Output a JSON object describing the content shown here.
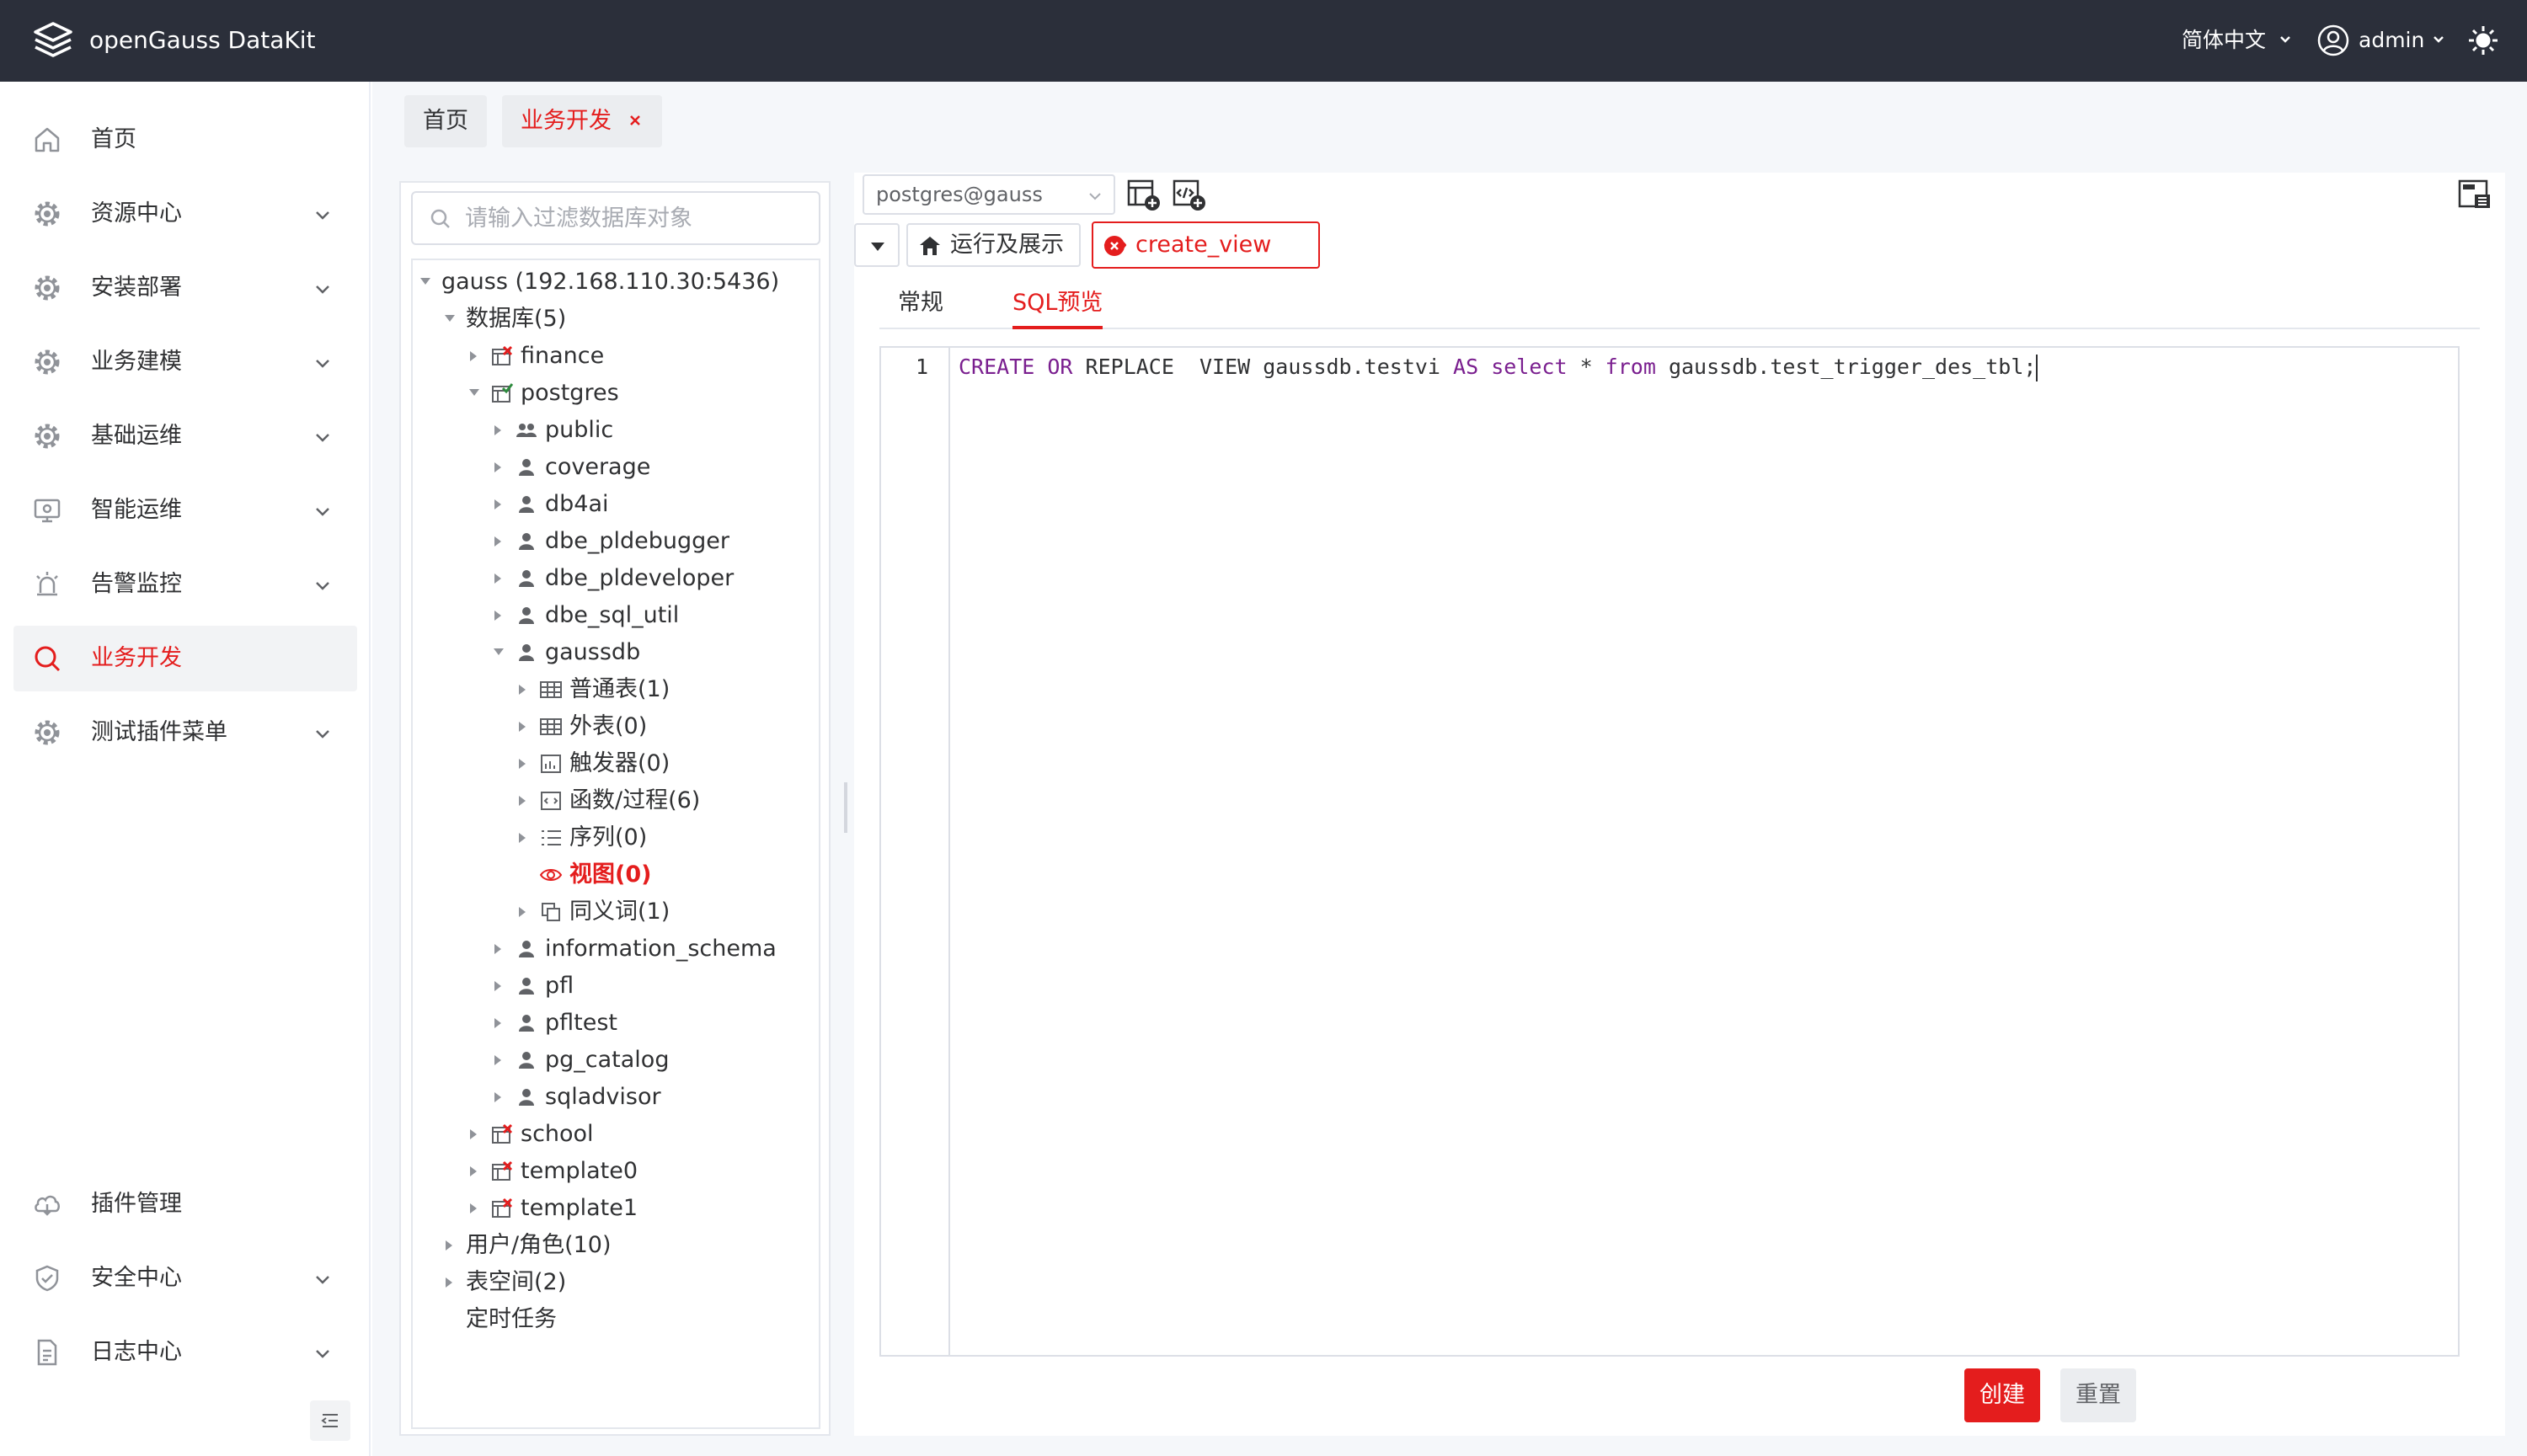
{
  "app": {
    "title": "openGauss DataKit"
  },
  "header": {
    "language": "简体中文",
    "user": "admin"
  },
  "sidebar": {
    "items": [
      {
        "label": "首页",
        "icon": "home-icon"
      },
      {
        "label": "资源中心",
        "icon": "gear-icon"
      },
      {
        "label": "安装部署",
        "icon": "gear-icon"
      },
      {
        "label": "业务建模",
        "icon": "gear-icon"
      },
      {
        "label": "基础运维",
        "icon": "gear-icon"
      },
      {
        "label": "智能运维",
        "icon": "monitor-icon"
      },
      {
        "label": "告警监控",
        "icon": "alarm-icon"
      },
      {
        "label": "业务开发",
        "icon": "search-icon",
        "active": true
      },
      {
        "label": "测试插件菜单",
        "icon": "gear-icon"
      },
      {
        "label": "插件管理",
        "icon": "plugin-icon"
      },
      {
        "label": "安全中心",
        "icon": "shield-icon"
      },
      {
        "label": "日志中心",
        "icon": "document-icon"
      }
    ]
  },
  "tabs": [
    {
      "label": "首页"
    },
    {
      "label": "业务开发"
    }
  ],
  "filter": {
    "placeholder": "请输入过滤数据库对象"
  },
  "tree": [
    {
      "label": "gauss (192.168.110.30:5436)",
      "icon": "none",
      "arrow": "down"
    },
    {
      "label": "数据库(5)",
      "icon": "none",
      "arrow": "down"
    },
    {
      "label": "finance",
      "icon": "database-closed-icon",
      "arrow": "right"
    },
    {
      "label": "postgres",
      "icon": "database-open-icon",
      "arrow": "down"
    },
    {
      "label": "public",
      "icon": "users-icon",
      "arrow": "right"
    },
    {
      "label": "coverage",
      "icon": "user-icon",
      "arrow": "right"
    },
    {
      "label": "db4ai",
      "icon": "user-icon",
      "arrow": "right"
    },
    {
      "label": "dbe_pldebugger",
      "icon": "user-icon",
      "arrow": "right"
    },
    {
      "label": "dbe_pldeveloper",
      "icon": "user-icon",
      "arrow": "right"
    },
    {
      "label": "dbe_sql_util",
      "icon": "user-icon",
      "arrow": "right"
    },
    {
      "label": "gaussdb",
      "icon": "user-icon",
      "arrow": "down"
    },
    {
      "label": "普通表(1)",
      "icon": "table-icon",
      "arrow": "right"
    },
    {
      "label": "外表(0)",
      "icon": "table-icon",
      "arrow": "right"
    },
    {
      "label": "触发器(0)",
      "icon": "trigger-icon",
      "arrow": "right"
    },
    {
      "label": "函数/过程(6)",
      "icon": "function-icon",
      "arrow": "right"
    },
    {
      "label": "序列(0)",
      "icon": "sequence-icon",
      "arrow": "right"
    },
    {
      "label": "视图(0)",
      "icon": "eye-icon",
      "arrow": "none",
      "highlight": true
    },
    {
      "label": "同义词(1)",
      "icon": "synonym-icon",
      "arrow": "right"
    },
    {
      "label": "information_schema",
      "icon": "user-icon",
      "arrow": "right"
    },
    {
      "label": "pfl",
      "icon": "user-icon",
      "arrow": "right"
    },
    {
      "label": "pfltest",
      "icon": "user-icon",
      "arrow": "right"
    },
    {
      "label": "pg_catalog",
      "icon": "user-icon",
      "arrow": "right"
    },
    {
      "label": "sqladvisor",
      "icon": "user-icon",
      "arrow": "right"
    },
    {
      "label": "school",
      "icon": "database-closed-icon",
      "arrow": "right"
    },
    {
      "label": "template0",
      "icon": "database-closed-icon",
      "arrow": "right"
    },
    {
      "label": "template1",
      "icon": "database-closed-icon",
      "arrow": "right"
    },
    {
      "label": "用户/角色(10)",
      "icon": "none",
      "arrow": "right"
    },
    {
      "label": "表空间(2)",
      "icon": "none",
      "arrow": "right"
    },
    {
      "label": "定时任务",
      "icon": "none",
      "arrow": "none"
    }
  ],
  "connection": {
    "value": "postgres@gauss"
  },
  "work_tabs": {
    "run": "运行及展示",
    "view": "create_view"
  },
  "subtabs": {
    "general": "常规",
    "sql": "SQL预览"
  },
  "editor": {
    "line": "1",
    "code": [
      {
        "t": "CREATE",
        "k": true
      },
      {
        "t": " "
      },
      {
        "t": "OR",
        "k": true
      },
      {
        "t": " REPLACE  VIEW gaussdb.testvi "
      },
      {
        "t": "AS",
        "k": true
      },
      {
        "t": " "
      },
      {
        "t": "select",
        "k": true
      },
      {
        "t": " * "
      },
      {
        "t": "from",
        "k": true
      },
      {
        "t": " gaussdb.test_trigger_des_tbl;"
      }
    ]
  },
  "actions": {
    "create": "创建",
    "reset": "重置"
  },
  "colors": {
    "accent": "#e41d1d",
    "topbar": "#2b2f3a",
    "keyword": "#7a1f8f"
  }
}
